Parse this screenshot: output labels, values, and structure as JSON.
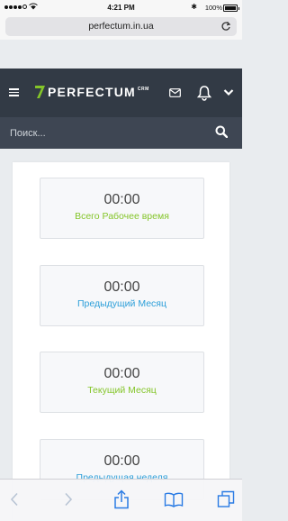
{
  "status_bar": {
    "time": "4:21 PM",
    "battery": "100%"
  },
  "browser": {
    "url": "perfectum.in.ua"
  },
  "app": {
    "logo_text": "PERFECTUM",
    "logo_suffix": "CRM",
    "accent_color": "#84c529",
    "header_color": "#323a45"
  },
  "search": {
    "placeholder": "Поиск..."
  },
  "cards": [
    {
      "value": "00:00",
      "label": "Всего Рабочее время",
      "color": "green"
    },
    {
      "value": "00:00",
      "label": "Предыдущий Месяц",
      "color": "blue"
    },
    {
      "value": "00:00",
      "label": "Текущий Месяц",
      "color": "green"
    },
    {
      "value": "00:00",
      "label": "Предыдущая неделя",
      "color": "blue"
    }
  ],
  "toolbar_icons": [
    "back-icon",
    "forward-icon",
    "share-icon",
    "bookmarks-icon",
    "tabs-icon"
  ]
}
